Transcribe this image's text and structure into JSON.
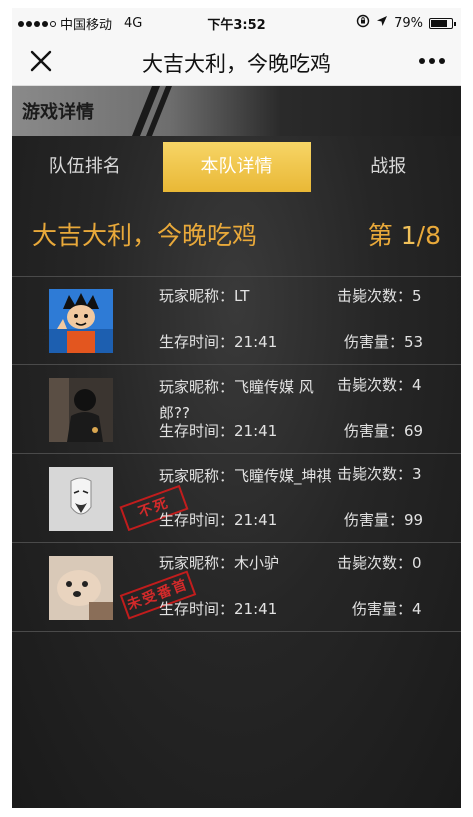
{
  "status_bar": {
    "carrier": "中国移动",
    "network": "4G",
    "time": "下午3:52",
    "battery": "79%",
    "battery_level": 0.79
  },
  "nav": {
    "title": "大吉大利，今晚吃鸡"
  },
  "section_header": "游戏详情",
  "tabs": [
    {
      "label": "队伍排名",
      "active": false
    },
    {
      "label": "本队详情",
      "active": true
    },
    {
      "label": "战报",
      "active": false
    }
  ],
  "team": {
    "name": "大吉大利，今晚吃鸡",
    "rank_prefix": "第 ",
    "rank": "1",
    "rank_total": "/8"
  },
  "players": [
    {
      "nickname_label": "玩家昵称：",
      "nickname": "LT",
      "kills_label": "击毙次数：",
      "kills": "5",
      "time_label": "生存时间：",
      "time": "21:41",
      "damage_label": "伤害量：",
      "damage": "53",
      "stamp": ""
    },
    {
      "nickname_label": "玩家昵称：",
      "nickname": "飞瞳传媒 风郎??",
      "kills_label": "击毙次数：",
      "kills": "4",
      "time_label": "生存时间：",
      "time": "21:41",
      "damage_label": "伤害量：",
      "damage": "69",
      "stamp": ""
    },
    {
      "nickname_label": "玩家昵称：",
      "nickname": "飞瞳传媒_坤祺",
      "kills_label": "击毙次数：",
      "kills": "3",
      "time_label": "生存时间：",
      "time": "21:41",
      "damage_label": "伤害量：",
      "damage": "99",
      "stamp": "不死"
    },
    {
      "nickname_label": "玩家昵称：",
      "nickname": "木小驴",
      "kills_label": "击毙次数：",
      "kills": "0",
      "time_label": "生存时间：",
      "time": "21:41",
      "damage_label": "伤害量：",
      "damage": "4",
      "stamp": "未受番首"
    }
  ],
  "colors": {
    "accent_gold": "#e9a93a",
    "tab_active": "#f0c54e",
    "stamp_red": "#d21c1c"
  }
}
